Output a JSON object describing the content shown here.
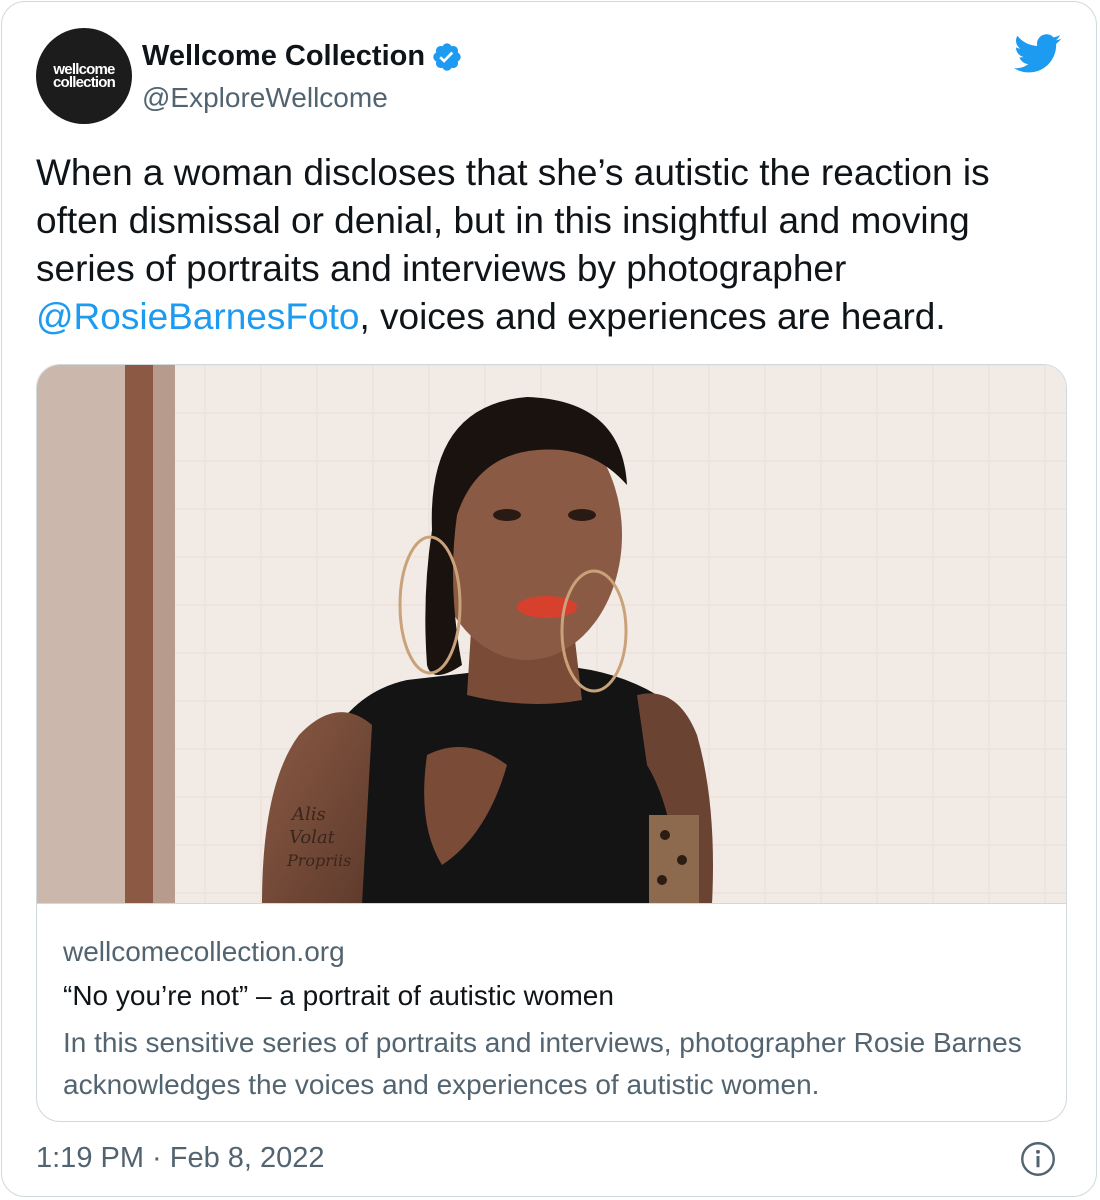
{
  "author": {
    "avatar_text_line1": "wellcome",
    "avatar_text_line2": "collection",
    "display_name": "Wellcome Collection",
    "handle": "@ExploreWellcome",
    "verified_icon": "verified-badge-icon"
  },
  "tweet": {
    "text_before_mention": "When a woman discloses that she’s autistic the reaction is often dismissal or denial, but in this insightful and moving series of portraits and interviews by photographer ",
    "mention": "@RosieBarnesFoto",
    "text_after_mention": ", voices and experiences are heard.",
    "timestamp": "1:19 PM · Feb 8, 2022"
  },
  "card": {
    "domain": "wellcomecollection.org",
    "title": "“No you’re not” – a portrait of autistic women",
    "description": "In this sensitive series of portraits and interviews, photographer Rosie Barnes acknowledges the voices and experiences of autistic women.",
    "image_tattoo_text_1": "Alis",
    "image_tattoo_text_2": "Volat",
    "image_tattoo_text_3": "Propriis"
  },
  "icons": {
    "brand": "twitter-bird-icon",
    "info": "info-icon"
  },
  "colors": {
    "link": "#1d9bf0",
    "twitter_blue": "#1d9bf0",
    "text_primary": "#0f1419",
    "text_secondary": "#536471",
    "border": "#cfd9de"
  }
}
